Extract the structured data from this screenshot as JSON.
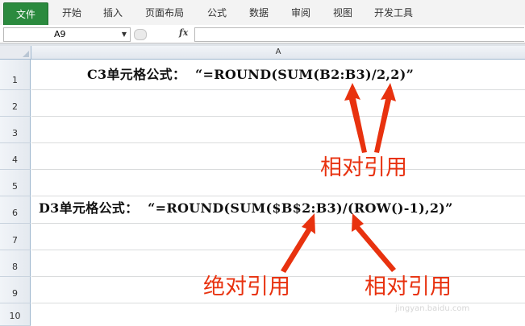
{
  "ribbon": {
    "file_tab": "文件",
    "tabs": [
      "开始",
      "插入",
      "页面布局",
      "公式",
      "数据",
      "审阅",
      "视图",
      "开发工具"
    ]
  },
  "formula_bar": {
    "name_box": "A9",
    "fx_label": "fx",
    "formula": ""
  },
  "grid": {
    "column_header": "A",
    "rows": [
      "1",
      "2",
      "3",
      "4",
      "5",
      "6",
      "7",
      "8",
      "9",
      "10"
    ],
    "row1_text": "C3单元格公式：  “=ROUND(SUM(B2:B3)/2,2)”",
    "row6_text": "D3单元格公式：  “=ROUND(SUM($B$2:B3)/(ROW()-1),2)”"
  },
  "annotations": {
    "relative_ref_top": "相对引用",
    "absolute_ref": "绝对引用",
    "relative_ref_bottom": "相对引用",
    "color": "#e8320f"
  },
  "watermark": {
    "text": "jingyan.baidu.com"
  }
}
